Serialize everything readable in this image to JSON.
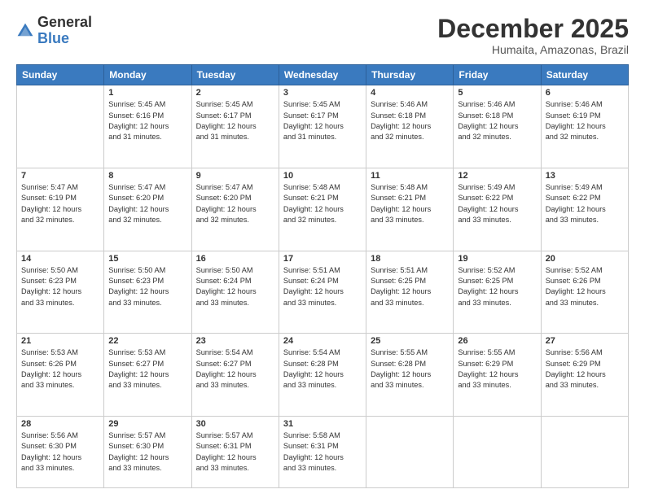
{
  "logo": {
    "general": "General",
    "blue": "Blue"
  },
  "header": {
    "month": "December 2025",
    "location": "Humaita, Amazonas, Brazil"
  },
  "days": [
    "Sunday",
    "Monday",
    "Tuesday",
    "Wednesday",
    "Thursday",
    "Friday",
    "Saturday"
  ],
  "weeks": [
    [
      {
        "num": "",
        "info": ""
      },
      {
        "num": "1",
        "info": "Sunrise: 5:45 AM\nSunset: 6:16 PM\nDaylight: 12 hours\nand 31 minutes."
      },
      {
        "num": "2",
        "info": "Sunrise: 5:45 AM\nSunset: 6:17 PM\nDaylight: 12 hours\nand 31 minutes."
      },
      {
        "num": "3",
        "info": "Sunrise: 5:45 AM\nSunset: 6:17 PM\nDaylight: 12 hours\nand 31 minutes."
      },
      {
        "num": "4",
        "info": "Sunrise: 5:46 AM\nSunset: 6:18 PM\nDaylight: 12 hours\nand 32 minutes."
      },
      {
        "num": "5",
        "info": "Sunrise: 5:46 AM\nSunset: 6:18 PM\nDaylight: 12 hours\nand 32 minutes."
      },
      {
        "num": "6",
        "info": "Sunrise: 5:46 AM\nSunset: 6:19 PM\nDaylight: 12 hours\nand 32 minutes."
      }
    ],
    [
      {
        "num": "7",
        "info": "Sunrise: 5:47 AM\nSunset: 6:19 PM\nDaylight: 12 hours\nand 32 minutes."
      },
      {
        "num": "8",
        "info": "Sunrise: 5:47 AM\nSunset: 6:20 PM\nDaylight: 12 hours\nand 32 minutes."
      },
      {
        "num": "9",
        "info": "Sunrise: 5:47 AM\nSunset: 6:20 PM\nDaylight: 12 hours\nand 32 minutes."
      },
      {
        "num": "10",
        "info": "Sunrise: 5:48 AM\nSunset: 6:21 PM\nDaylight: 12 hours\nand 32 minutes."
      },
      {
        "num": "11",
        "info": "Sunrise: 5:48 AM\nSunset: 6:21 PM\nDaylight: 12 hours\nand 33 minutes."
      },
      {
        "num": "12",
        "info": "Sunrise: 5:49 AM\nSunset: 6:22 PM\nDaylight: 12 hours\nand 33 minutes."
      },
      {
        "num": "13",
        "info": "Sunrise: 5:49 AM\nSunset: 6:22 PM\nDaylight: 12 hours\nand 33 minutes."
      }
    ],
    [
      {
        "num": "14",
        "info": "Sunrise: 5:50 AM\nSunset: 6:23 PM\nDaylight: 12 hours\nand 33 minutes."
      },
      {
        "num": "15",
        "info": "Sunrise: 5:50 AM\nSunset: 6:23 PM\nDaylight: 12 hours\nand 33 minutes."
      },
      {
        "num": "16",
        "info": "Sunrise: 5:50 AM\nSunset: 6:24 PM\nDaylight: 12 hours\nand 33 minutes."
      },
      {
        "num": "17",
        "info": "Sunrise: 5:51 AM\nSunset: 6:24 PM\nDaylight: 12 hours\nand 33 minutes."
      },
      {
        "num": "18",
        "info": "Sunrise: 5:51 AM\nSunset: 6:25 PM\nDaylight: 12 hours\nand 33 minutes."
      },
      {
        "num": "19",
        "info": "Sunrise: 5:52 AM\nSunset: 6:25 PM\nDaylight: 12 hours\nand 33 minutes."
      },
      {
        "num": "20",
        "info": "Sunrise: 5:52 AM\nSunset: 6:26 PM\nDaylight: 12 hours\nand 33 minutes."
      }
    ],
    [
      {
        "num": "21",
        "info": "Sunrise: 5:53 AM\nSunset: 6:26 PM\nDaylight: 12 hours\nand 33 minutes."
      },
      {
        "num": "22",
        "info": "Sunrise: 5:53 AM\nSunset: 6:27 PM\nDaylight: 12 hours\nand 33 minutes."
      },
      {
        "num": "23",
        "info": "Sunrise: 5:54 AM\nSunset: 6:27 PM\nDaylight: 12 hours\nand 33 minutes."
      },
      {
        "num": "24",
        "info": "Sunrise: 5:54 AM\nSunset: 6:28 PM\nDaylight: 12 hours\nand 33 minutes."
      },
      {
        "num": "25",
        "info": "Sunrise: 5:55 AM\nSunset: 6:28 PM\nDaylight: 12 hours\nand 33 minutes."
      },
      {
        "num": "26",
        "info": "Sunrise: 5:55 AM\nSunset: 6:29 PM\nDaylight: 12 hours\nand 33 minutes."
      },
      {
        "num": "27",
        "info": "Sunrise: 5:56 AM\nSunset: 6:29 PM\nDaylight: 12 hours\nand 33 minutes."
      }
    ],
    [
      {
        "num": "28",
        "info": "Sunrise: 5:56 AM\nSunset: 6:30 PM\nDaylight: 12 hours\nand 33 minutes."
      },
      {
        "num": "29",
        "info": "Sunrise: 5:57 AM\nSunset: 6:30 PM\nDaylight: 12 hours\nand 33 minutes."
      },
      {
        "num": "30",
        "info": "Sunrise: 5:57 AM\nSunset: 6:31 PM\nDaylight: 12 hours\nand 33 minutes."
      },
      {
        "num": "31",
        "info": "Sunrise: 5:58 AM\nSunset: 6:31 PM\nDaylight: 12 hours\nand 33 minutes."
      },
      {
        "num": "",
        "info": ""
      },
      {
        "num": "",
        "info": ""
      },
      {
        "num": "",
        "info": ""
      }
    ]
  ]
}
